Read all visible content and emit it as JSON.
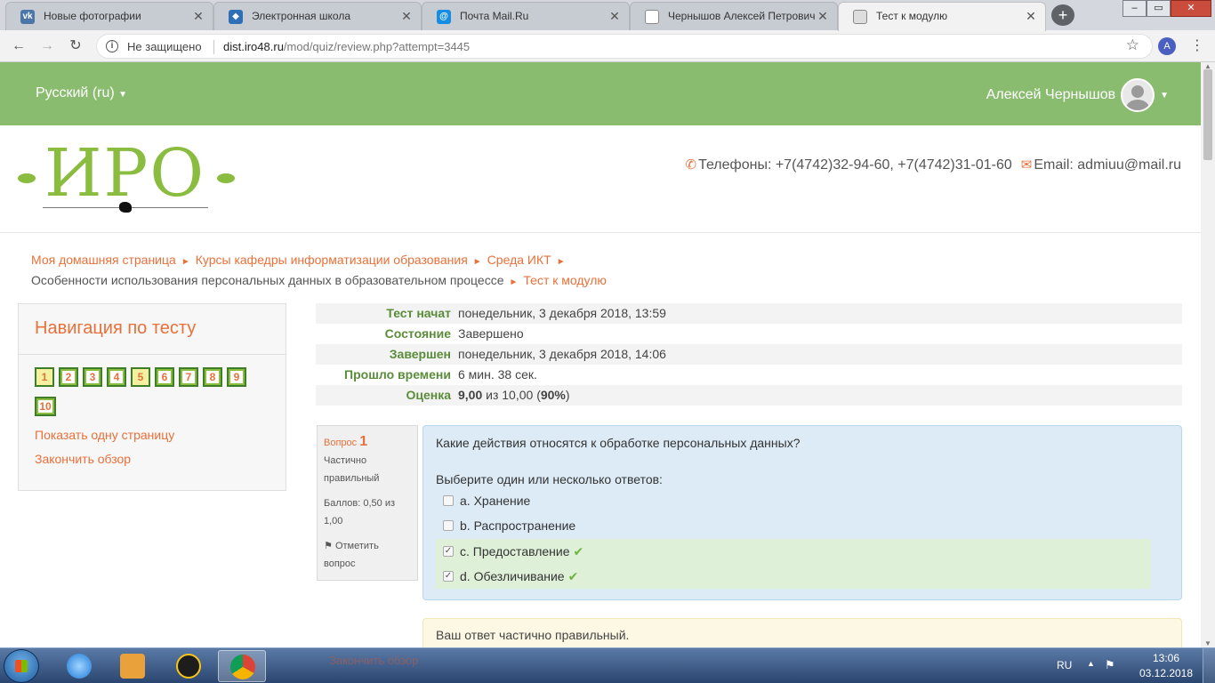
{
  "tabs": [
    {
      "title": "Новые фотографии",
      "icon": "vk-icon",
      "color": "#4a76a8"
    },
    {
      "title": "Электронная школа",
      "icon": "school-icon",
      "color": "#2f6fb5"
    },
    {
      "title": "Почта Mail.Ru",
      "icon": "mailru-icon",
      "color": "#168de2"
    },
    {
      "title": "Чернышов Алексей Петрович",
      "icon": "document-icon",
      "color": "#888888"
    },
    {
      "title": "Тест к модулю",
      "icon": "page-icon",
      "color": "#888888"
    }
  ],
  "address": {
    "security": "Не защищено",
    "host": "dist.iro48.ru",
    "path": "/mod/quiz/review.php?attempt=3445"
  },
  "profile_initial": "A",
  "topbar": {
    "language": "Русский (ru)",
    "user_name": "Алексей Чернышов"
  },
  "header": {
    "logo_text": "ИРО",
    "phones": "Телефоны: +7(4742)32-94-60, +7(4742)31-01-60",
    "email": "Email: admiuu@mail.ru"
  },
  "breadcrumb": {
    "items": [
      "Моя домашняя страница",
      "Курсы кафедры информатизации образования",
      "Среда ИКТ",
      "Особенности использования персональных данных в образовательном процессе",
      "Тест к модулю"
    ]
  },
  "quiz_nav": {
    "title": "Навигация по тесту",
    "questions": [
      "1",
      "2",
      "3",
      "4",
      "5",
      "6",
      "7",
      "8",
      "9",
      "10"
    ],
    "show_one_page": "Показать одну страницу",
    "finish_review": "Закончить обзор"
  },
  "summary": {
    "rows": [
      {
        "label": "Тест начат",
        "value": "понедельник, 3 декабря 2018, 13:59"
      },
      {
        "label": "Состояние",
        "value": "Завершено"
      },
      {
        "label": "Завершен",
        "value": "понедельник, 3 декабря 2018, 14:06"
      },
      {
        "label": "Прошло времени",
        "value": "6 мин. 38 сек."
      }
    ],
    "grade_label": "Оценка",
    "grade_value": "9,00",
    "grade_of": "из 10,00 (",
    "grade_percent": "90%",
    "grade_close": ")"
  },
  "question": {
    "label": "Вопрос",
    "number": "1",
    "state": "Частично правильный",
    "marks": "Баллов: 0,50 из 1,00",
    "flag_label": "Отметить вопрос",
    "text": "Какие действия относятся к обработке персональных данных?",
    "prompt": "Выберите один или несколько ответов:",
    "answers": [
      {
        "text": "a. Хранение",
        "checked": false,
        "correct": false
      },
      {
        "text": "b. Распространение",
        "checked": false,
        "correct": false
      },
      {
        "text": "c. Предоставление",
        "checked": true,
        "correct": true
      },
      {
        "text": "d. Обезличивание",
        "checked": true,
        "correct": true
      }
    ],
    "feedback": "Ваш ответ частично правильный."
  },
  "taskbar": {
    "language": "RU",
    "time": "13:06",
    "date": "03.12.2018",
    "ghost_text": "Закончить обзор"
  },
  "colors": {
    "accent": "#e8703a",
    "topbar": "#8abc6f",
    "logo": "#8abc3f",
    "label_green": "#5a8c3a"
  }
}
